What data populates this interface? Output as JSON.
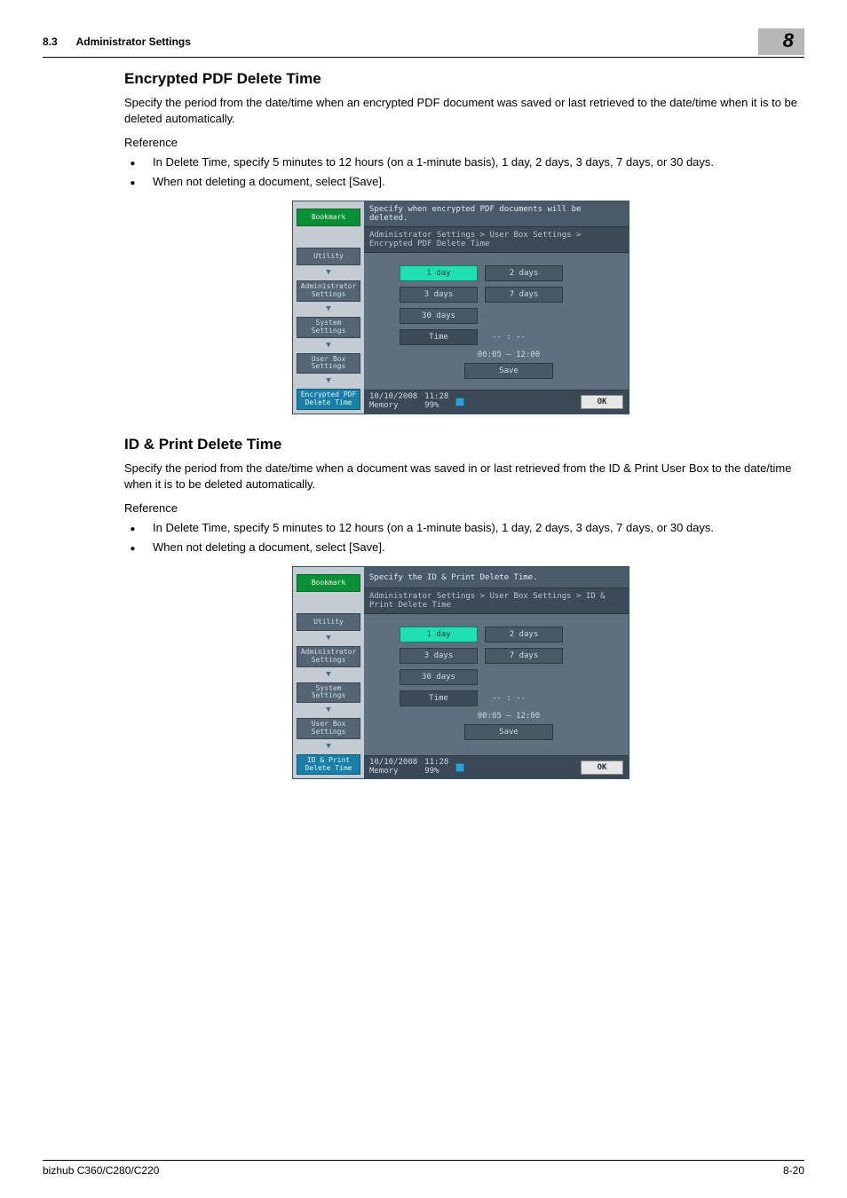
{
  "header": {
    "section_num": "8.3",
    "section_title": "Administrator Settings",
    "chapter": "8"
  },
  "section1": {
    "title": "Encrypted PDF Delete Time",
    "intro": "Specify the period from the date/time when an encrypted PDF document was saved or last retrieved to the date/time when it is to be deleted automatically.",
    "reference_label": "Reference",
    "bullets": [
      "In Delete Time, specify 5 minutes to 12 hours (on a 1-minute basis), 1 day, 2 days, 3 days, 7 days, or 30 days.",
      "When not deleting a document, select [Save]."
    ],
    "ss": {
      "top": "Specify when encrypted PDF documents will be deleted.",
      "breadcrumb": "Administrator Settings > User Box Settings > Encrypted PDF Delete Time",
      "side_bookmark": "Bookmark",
      "side_items": [
        "Utility",
        "Administrator Settings",
        "System Settings",
        "User Box Settings"
      ],
      "side_current": "Encrypted PDF Delete Time",
      "opts": {
        "sel": "1 day",
        "b": "2 days",
        "c": "3 days",
        "d": "7 days",
        "e": "30 days"
      },
      "time_label": "Time",
      "time_value": "-- : --",
      "range": "00:05  –  12:00",
      "save": "Save",
      "date": "10/10/2008",
      "clock": "11:28",
      "memory_label": "Memory",
      "memory_val": "99%",
      "ok": "OK"
    }
  },
  "section2": {
    "title": "ID & Print Delete Time",
    "intro": "Specify the period from the date/time when a document was saved in or last retrieved from the ID & Print User Box to the date/time when it is to be deleted automatically.",
    "reference_label": "Reference",
    "bullets": [
      "In Delete Time, specify 5 minutes to 12 hours (on a 1-minute basis), 1 day, 2 days, 3 days, 7 days, or 30 days.",
      "When not deleting a document, select [Save]."
    ],
    "ss": {
      "top": "Specify the ID & Print Delete Time.",
      "breadcrumb": "Administrator Settings > User Box Settings > ID & Print Delete Time",
      "side_bookmark": "Bookmark",
      "side_items": [
        "Utility",
        "Administrator Settings",
        "System Settings",
        "User Box Settings"
      ],
      "side_current": "ID & Print Delete Time",
      "opts": {
        "sel": "1 day",
        "b": "2 days",
        "c": "3 days",
        "d": "7 days",
        "e": "30 days"
      },
      "time_label": "Time",
      "time_value": "-- : --",
      "range": "00:05  –  12:00",
      "save": "Save",
      "date": "10/10/2008",
      "clock": "11:28",
      "memory_label": "Memory",
      "memory_val": "99%",
      "ok": "OK"
    }
  },
  "footer": {
    "left": "bizhub C360/C280/C220",
    "right": "8-20"
  }
}
